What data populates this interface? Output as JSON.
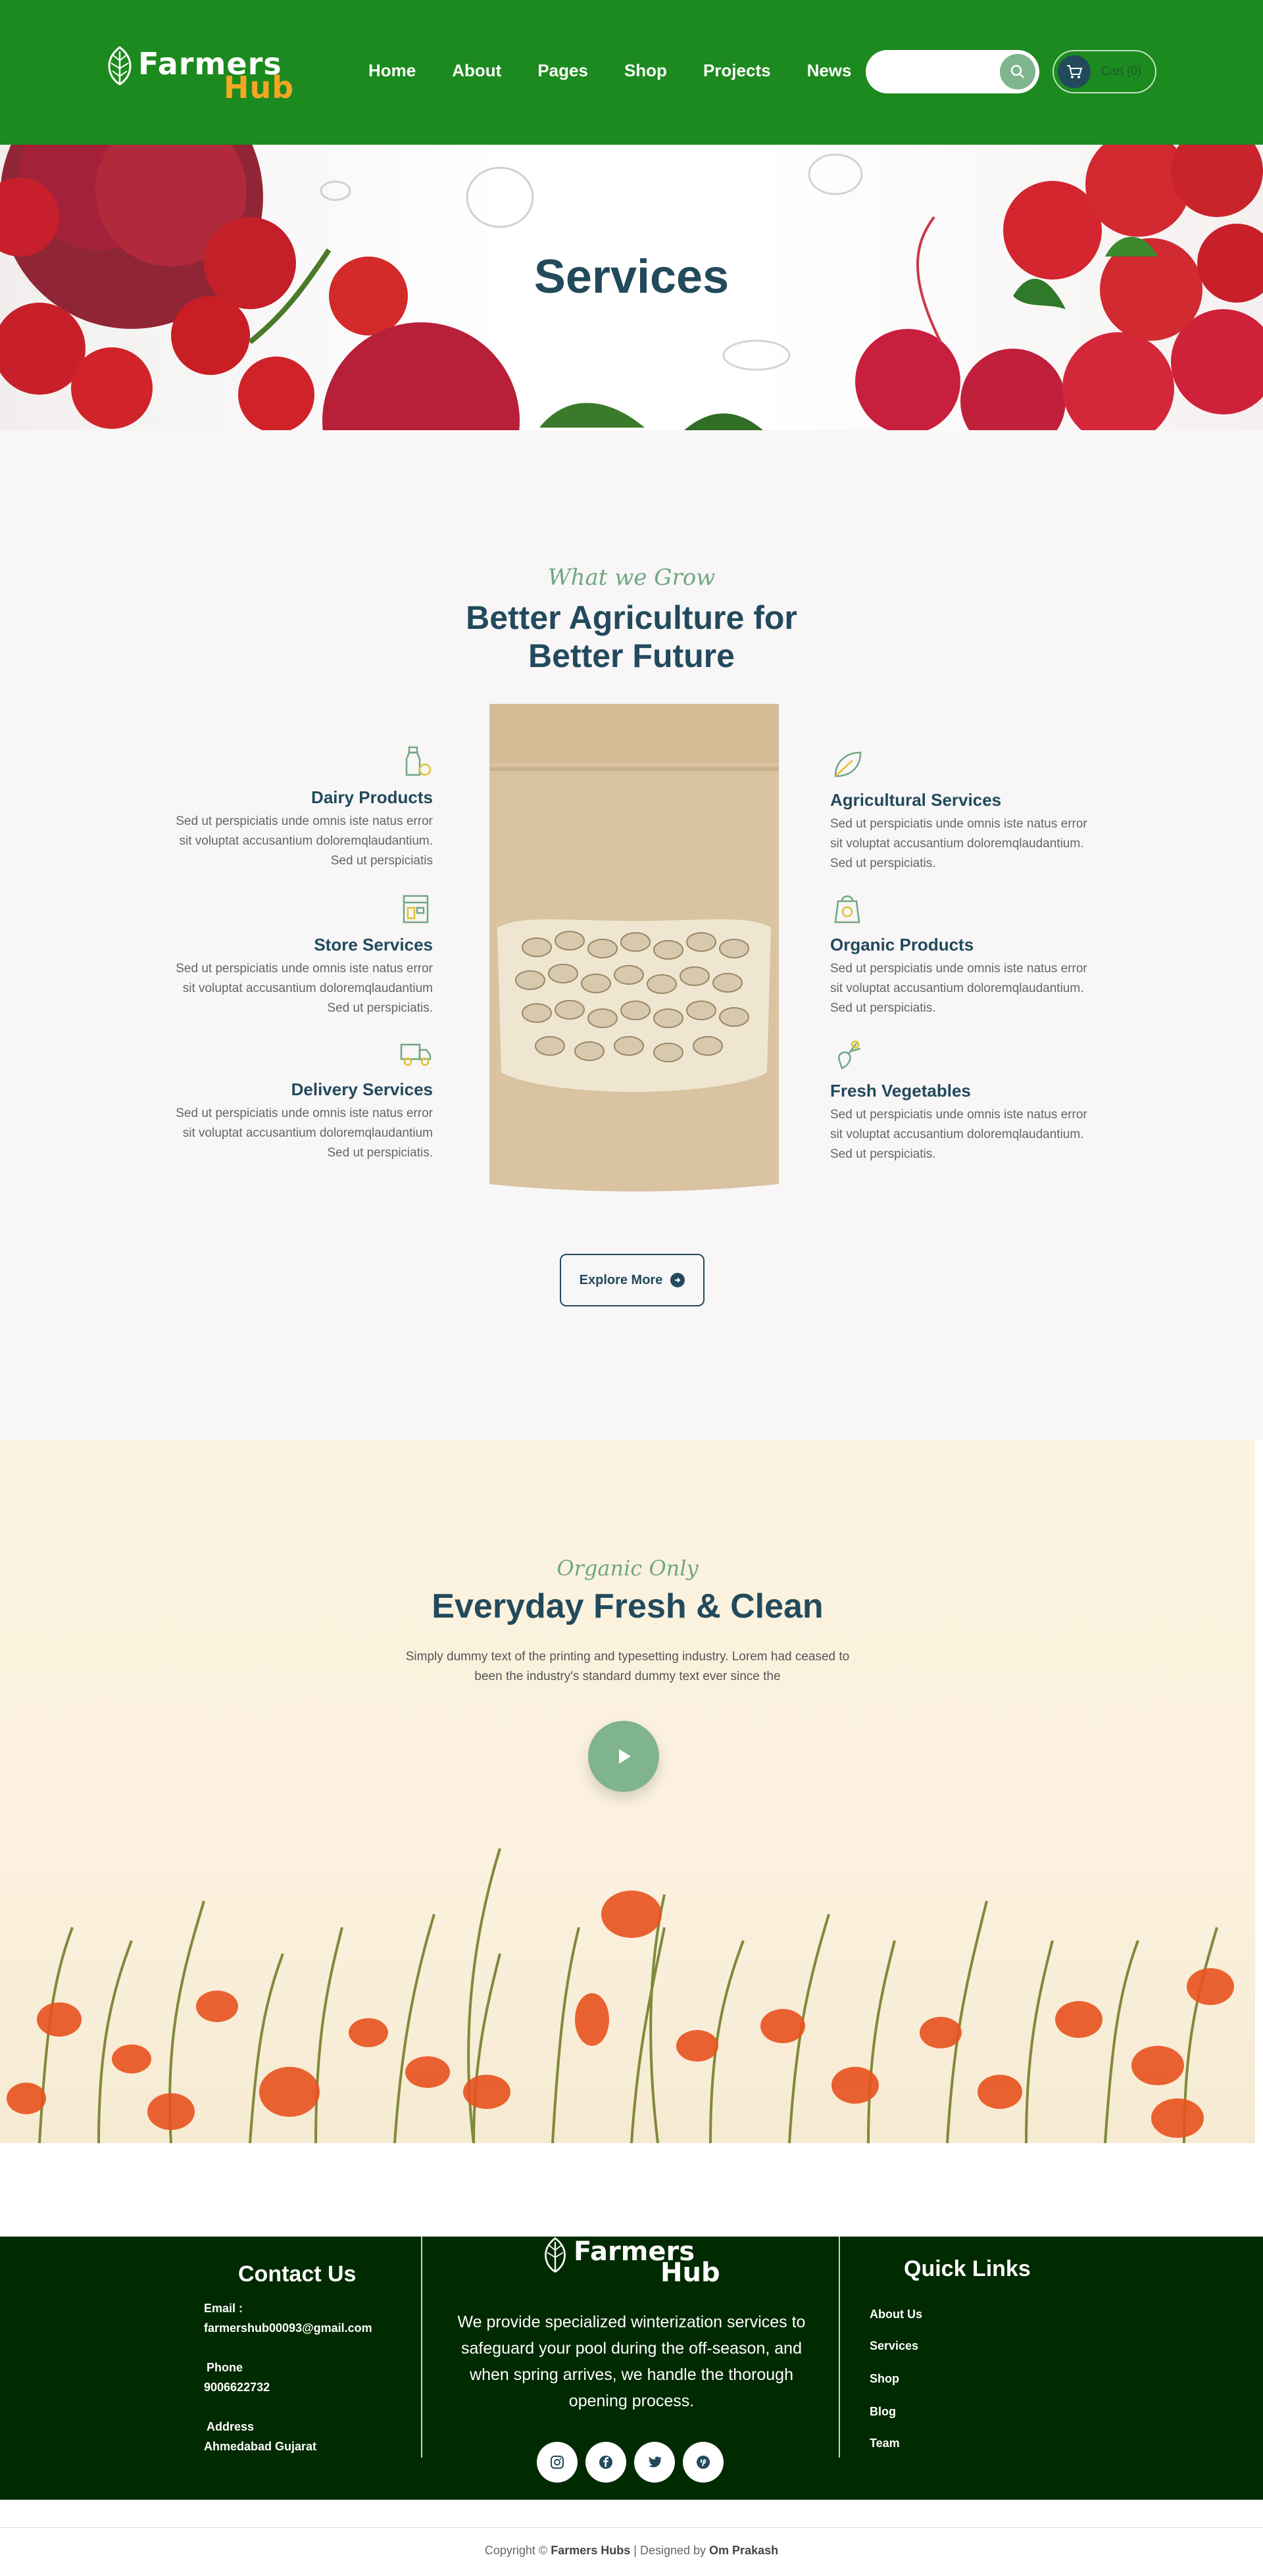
{
  "brand": {
    "word1": "Farmers",
    "word2": "Hub",
    "accent_green": "#1c8a1e",
    "accent_orange": "#f5a623",
    "navy": "#224a5c"
  },
  "nav": {
    "items": [
      "Home",
      "About",
      "Pages",
      "Shop",
      "Projects",
      "News"
    ]
  },
  "search": {
    "placeholder": "",
    "icon": "search-icon"
  },
  "cart": {
    "label": "Cart (0)",
    "icon": "cart-icon"
  },
  "hero": {
    "title": "Services"
  },
  "services": {
    "subtitle": "What we Grow",
    "title_line1": "Better Agriculture for",
    "title_line2": "Better Future",
    "left": [
      {
        "title": "Dairy Products",
        "desc": "Sed ut perspiciatis unde omnis iste natus error sit voluptat accusantium doloremqlaudantium. Sed ut perspiciatis",
        "icon": "milk-bottle-icon"
      },
      {
        "title": "Store Services",
        "desc": "Sed ut perspiciatis unde omnis iste natus error sit voluptat accusantium doloremqlaudantium Sed ut perspiciatis.",
        "icon": "store-icon"
      },
      {
        "title": "Delivery Services",
        "desc": "Sed ut perspiciatis unde omnis iste natus error sit voluptat accusantium doloremqlaudantium Sed ut perspiciatis.",
        "icon": "delivery-truck-icon"
      }
    ],
    "right": [
      {
        "title": "Agricultural Services",
        "desc": "Sed ut perspiciatis unde omnis iste natus error sit voluptat accusantium doloremqlaudantium. Sed ut perspiciatis.",
        "icon": "leaf-icon"
      },
      {
        "title": "Organic Products",
        "desc": "Sed ut perspiciatis unde omnis iste natus error sit voluptat accusantium doloremqlaudantium. Sed ut perspiciatis.",
        "icon": "organic-bag-icon"
      },
      {
        "title": "Fresh Vegetables",
        "desc": "Sed ut perspiciatis unde omnis iste natus error sit voluptat accusantium doloremqlaudantium. Sed ut perspiciatis.",
        "icon": "radish-icon"
      }
    ],
    "button": "Explore More"
  },
  "organic": {
    "subtitle": "Organic Only",
    "title": "Everyday Fresh & Clean",
    "text": "Simply dummy text of the printing and typesetting industry. Lorem had ceased to been the industry's standard dummy text ever since the"
  },
  "footer": {
    "contact_title": "Contact Us",
    "email_label": "Email :",
    "email": "farmershub00093@gmail.com",
    "phone_label": "Phone",
    "phone": "9006622732",
    "address_label": "Address",
    "address": "Ahmedabad Gujarat",
    "center_text": "We provide specialized winterization services to safeguard your pool during the off-season, and when spring arrives, we handle the thorough opening process.",
    "links_title": "Quick Links",
    "links": [
      "About Us",
      "Services",
      "Shop",
      "Blog",
      "Team"
    ],
    "social": [
      "instagram-icon",
      "facebook-icon",
      "twitter-icon",
      "pinterest-icon"
    ]
  },
  "copyright": {
    "prefix": "Copyright ©",
    "brand": "Farmers Hubs",
    "mid": "| Designed by",
    "designer": "Om Prakash"
  }
}
